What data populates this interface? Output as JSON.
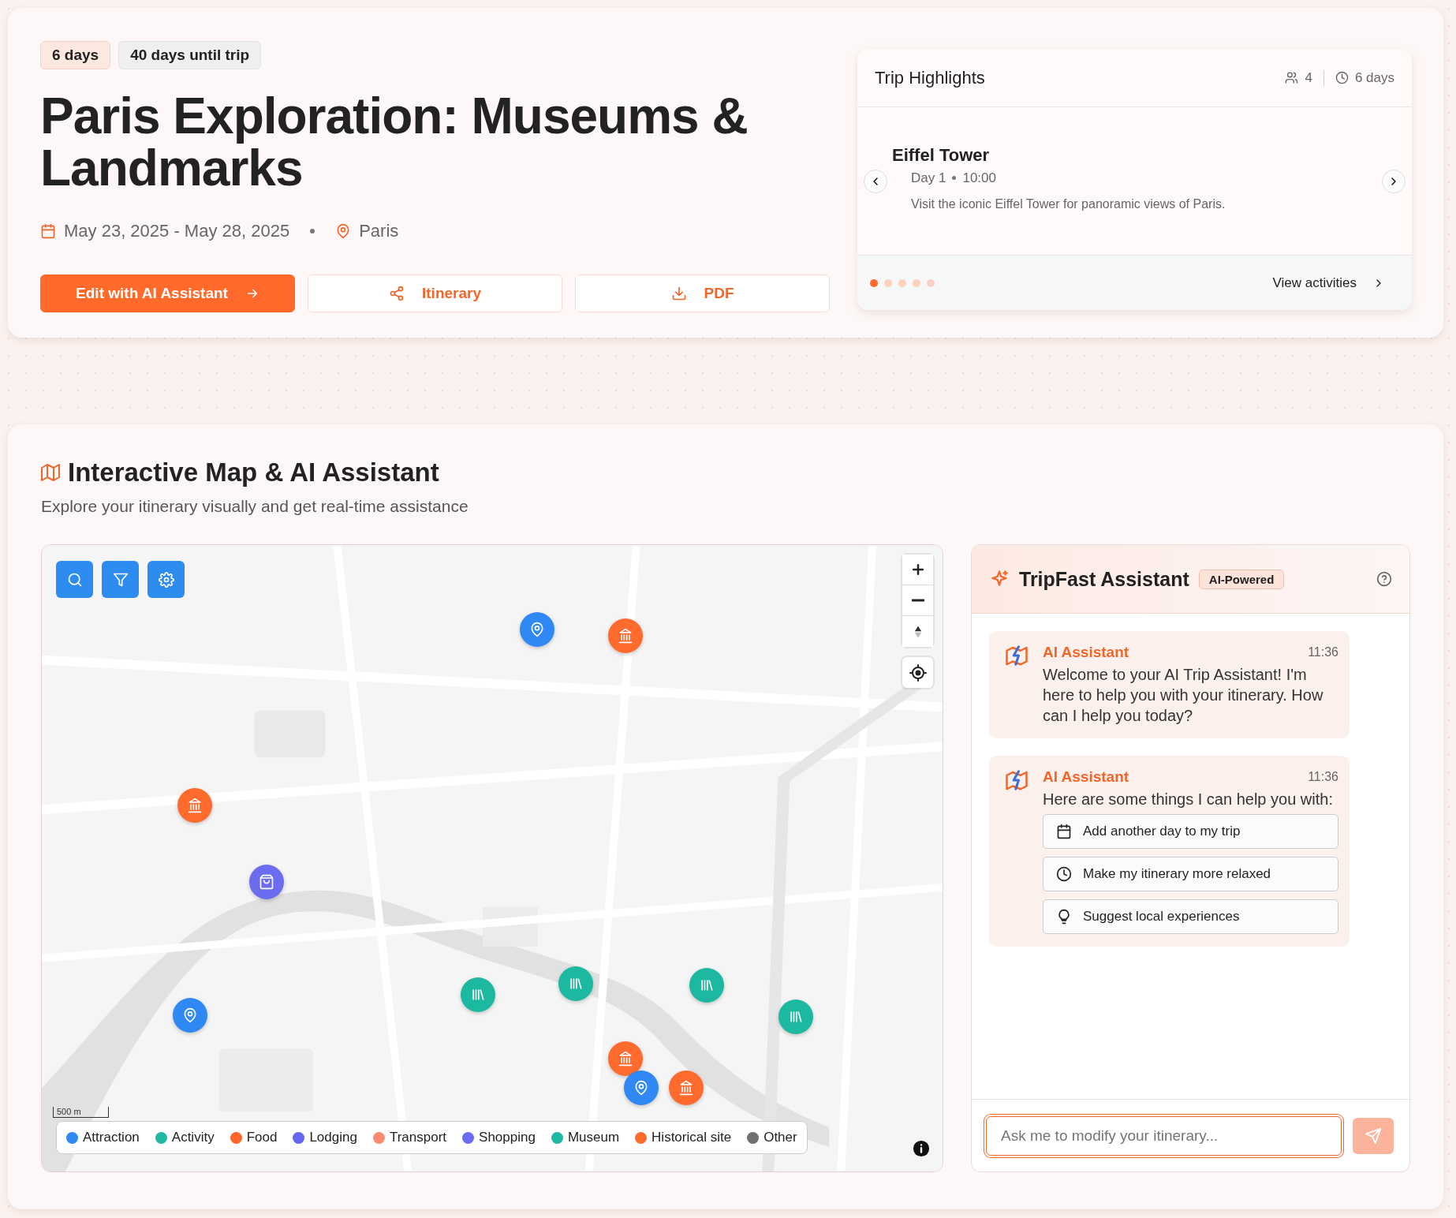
{
  "trip": {
    "badges": [
      {
        "label": "6 days",
        "kind": "duration"
      },
      {
        "label": "40 days until trip",
        "kind": "countdown"
      }
    ],
    "title": "Paris Exploration: Museums & Landmarks",
    "dates": "May 23, 2025 - May 28, 2025",
    "location": "Paris",
    "buttons": [
      {
        "label": "Edit with AI Assistant",
        "kind": "primary"
      },
      {
        "label": "Itinerary",
        "kind": "share"
      },
      {
        "label": "PDF",
        "kind": "download"
      }
    ]
  },
  "highlights": {
    "title": "Trip Highlights",
    "travelers": "4",
    "duration": "6 days",
    "item": {
      "name": "Eiffel Tower",
      "day": "Day 1",
      "time": "10:00",
      "description": "Visit the iconic Eiffel Tower for panoramic views of Paris."
    },
    "dots": [
      {
        "selected": true
      },
      {
        "selected": false
      },
      {
        "selected": false
      },
      {
        "selected": false
      },
      {
        "selected": false
      }
    ],
    "link": "View activities"
  },
  "section": {
    "title": "Interactive Map & AI Assistant",
    "subtitle": "Explore your itinerary visually and get real-time assistance"
  },
  "map": {
    "scale": "500 m",
    "markers": [
      {
        "kind": "attraction"
      },
      {
        "kind": "historical"
      },
      {
        "kind": "historical"
      },
      {
        "kind": "shopping"
      },
      {
        "kind": "museum"
      },
      {
        "kind": "museum"
      },
      {
        "kind": "museum"
      },
      {
        "kind": "museum"
      },
      {
        "kind": "attraction"
      },
      {
        "kind": "historical"
      },
      {
        "kind": "attraction"
      },
      {
        "kind": "historical"
      }
    ],
    "legend": [
      {
        "kind": "attraction",
        "label": "Attraction",
        "color": "#3088f4"
      },
      {
        "kind": "activity",
        "label": "Activity",
        "color": "#1fb8a2"
      },
      {
        "kind": "food",
        "label": "Food",
        "color": "#ff6628"
      },
      {
        "kind": "lodging",
        "label": "Lodging",
        "color": "#6366f1"
      },
      {
        "kind": "transport",
        "label": "Transport",
        "color": "#fb8a6e"
      },
      {
        "kind": "shopping",
        "label": "Shopping",
        "color": "#6b6cf0"
      },
      {
        "kind": "museum",
        "label": "Museum",
        "color": "#1cb8a0"
      },
      {
        "kind": "historical",
        "label": "Historical site",
        "color": "#ff6a2d"
      },
      {
        "kind": "other",
        "label": "Other",
        "color": "#707070"
      }
    ]
  },
  "assistant": {
    "title": "TripFast Assistant",
    "badge": "AI-Powered",
    "messages": [
      {
        "sender": "AI Assistant",
        "time": "11:36",
        "text": "Welcome to your AI Trip Assistant! I'm here to help you with your itinerary. How can I help you today?"
      },
      {
        "sender": "AI Assistant",
        "time": "11:36",
        "text": "Here are some things I can help you with:",
        "suggestions": [
          {
            "kind": "calendar",
            "label": "Add another day to my trip"
          },
          {
            "kind": "clock",
            "label": "Make my itinerary more relaxed"
          },
          {
            "kind": "bulb",
            "label": "Suggest local experiences"
          }
        ]
      }
    ],
    "input": {
      "placeholder": "Ask me to modify your itinerary...",
      "focused": true,
      "send_disabled": true
    }
  }
}
